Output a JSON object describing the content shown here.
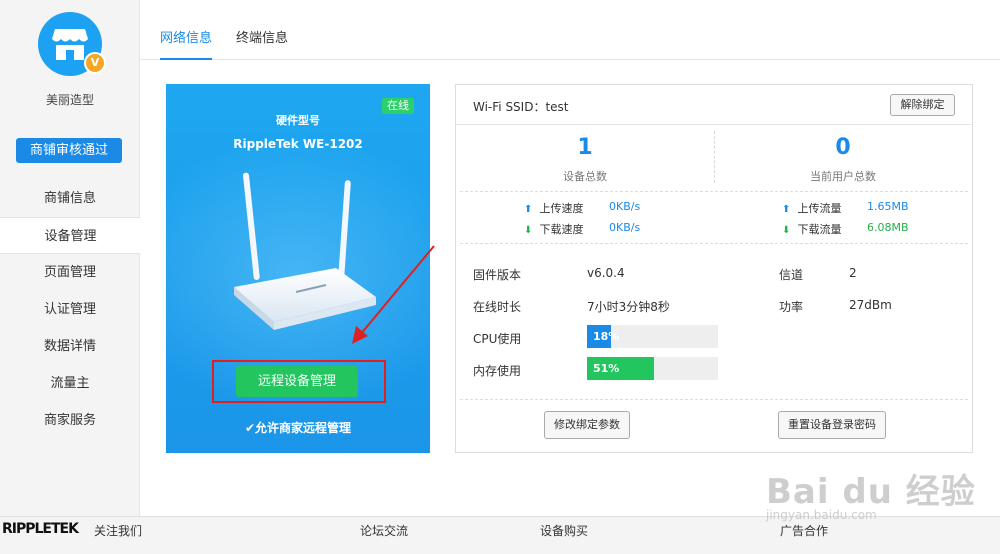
{
  "sidebar": {
    "shop_name": "美丽造型",
    "badge": "V",
    "audit_status": "商铺审核通过",
    "items": [
      {
        "label": "商铺信息"
      },
      {
        "label": "设备管理"
      },
      {
        "label": "页面管理"
      },
      {
        "label": "认证管理"
      },
      {
        "label": "数据详情"
      },
      {
        "label": "流量主"
      },
      {
        "label": "商家服务"
      }
    ],
    "active_index": 1
  },
  "tabs": [
    {
      "label": "网络信息"
    },
    {
      "label": "终端信息"
    }
  ],
  "device": {
    "status": "在线",
    "hw_label": "硬件型号",
    "model": "RippleTek WE-1202",
    "remote_button": "远程设备管理",
    "allow_remote": "✔允许商家远程管理"
  },
  "panel": {
    "ssid": "Wi-Fi SSID：test",
    "unbind": "解除绑定",
    "device_count": "1",
    "device_count_label": "设备总数",
    "user_count": "0",
    "user_count_label": "当前用户总数",
    "upload_speed_label": "上传速度",
    "upload_speed": "0KB/s",
    "download_speed_label": "下载速度",
    "download_speed": "0KB/s",
    "upload_traffic_label": "上传流量",
    "upload_traffic": "1.65MB",
    "download_traffic_label": "下载流量",
    "download_traffic": "6.08MB",
    "firmware_label": "固件版本",
    "firmware": "v6.0.4",
    "channel_label": "信道",
    "channel": "2",
    "uptime_label": "在线时长",
    "uptime": "7小时3分钟8秒",
    "power_label": "功率",
    "power": "27dBm",
    "cpu_label": "CPU使用",
    "cpu": "18%",
    "cpu_fraction": 0.18,
    "mem_label": "内存使用",
    "mem": "51%",
    "mem_fraction": 0.51,
    "modify_button": "修改绑定参数",
    "reset_button": "重置设备登录密码"
  },
  "footer": {
    "logo": "RIPPLETEK",
    "links": [
      {
        "label": "关注我们"
      },
      {
        "label": "论坛交流"
      },
      {
        "label": "设备购买"
      },
      {
        "label": "广告合作"
      }
    ]
  },
  "watermark": {
    "brand": "Bai du 经验",
    "url": "jingyan.baidu.com"
  },
  "colors": {
    "accent": "#1a8ae6",
    "card_blue": "#1ea7f0",
    "green": "#22c55e",
    "annotation_red": "#e02020"
  }
}
